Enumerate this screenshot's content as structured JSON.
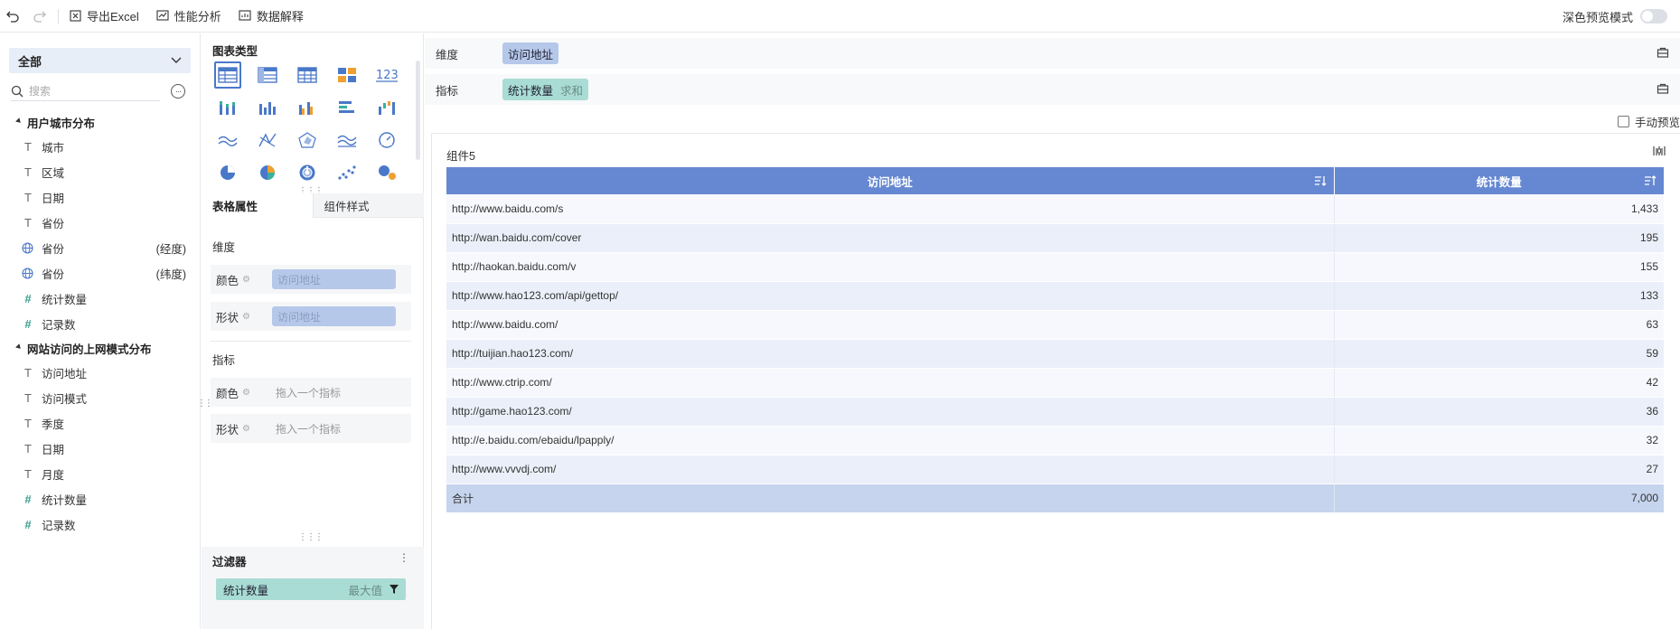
{
  "toolbar": {
    "undo_icon": "undo-icon",
    "redo_icon": "redo-icon",
    "export_label": "导出Excel",
    "perf_label": "性能分析",
    "explain_label": "数据解释",
    "dark_preview_label": "深色预览模式"
  },
  "left": {
    "select_value": "全部",
    "search_placeholder": "搜索",
    "groups": [
      {
        "title": "用户城市分布",
        "fields": [
          {
            "type": "T",
            "label": "城市"
          },
          {
            "type": "T",
            "label": "区域"
          },
          {
            "type": "T",
            "label": "日期"
          },
          {
            "type": "T",
            "label": "省份"
          },
          {
            "type": "globe",
            "label": "省份",
            "suffix": "(经度)"
          },
          {
            "type": "globe",
            "label": "省份",
            "suffix": "(纬度)"
          },
          {
            "type": "#",
            "label": "统计数量"
          },
          {
            "type": "#",
            "label": "记录数"
          }
        ]
      },
      {
        "title": "网站访问的上网模式分布",
        "fields": [
          {
            "type": "T",
            "label": "访问地址"
          },
          {
            "type": "T",
            "label": "访问模式"
          },
          {
            "type": "T",
            "label": "季度"
          },
          {
            "type": "T",
            "label": "日期"
          },
          {
            "type": "T",
            "label": "月度"
          },
          {
            "type": "#",
            "label": "统计数量"
          },
          {
            "type": "#",
            "label": "记录数"
          }
        ]
      }
    ]
  },
  "mid": {
    "chart_type_title": "图表类型",
    "tab_props": "表格属性",
    "tab_style": "组件样式",
    "dimension_title": "维度",
    "metric_title": "指标",
    "color_label": "颜色",
    "shape_label": "形状",
    "dim_color_value": "访问地址",
    "dim_shape_value": "访问地址",
    "metric_placeholder": "拖入一个指标",
    "filter_title": "过滤器",
    "filter_field": "统计数量",
    "filter_agg": "最大值"
  },
  "right": {
    "dimension_label": "维度",
    "dimension_value": "访问地址",
    "metric_label": "指标",
    "metric_value": "统计数量",
    "metric_agg": "求和",
    "manual_preview": "手动预览",
    "component_title": "组件5",
    "table": {
      "headers": [
        "访问地址",
        "统计数量"
      ],
      "rows": [
        [
          "http://www.baidu.com/s",
          "1,433"
        ],
        [
          "http://wan.baidu.com/cover",
          "195"
        ],
        [
          "http://haokan.baidu.com/v",
          "155"
        ],
        [
          "http://www.hao123.com/api/gettop/",
          "133"
        ],
        [
          "http://www.baidu.com/",
          "63"
        ],
        [
          "http://tuijian.hao123.com/",
          "59"
        ],
        [
          "http://www.ctrip.com/",
          "42"
        ],
        [
          "http://game.hao123.com/",
          "36"
        ],
        [
          "http://e.baidu.com/ebaidu/lpapply/",
          "32"
        ],
        [
          "http://www.vvvdj.com/",
          "27"
        ]
      ],
      "total_label": "合计",
      "total_value": "7,000"
    }
  },
  "colors": {
    "header_blue": "#6688d2",
    "dim_pill": "#b6c8ea",
    "metric_pill": "#a9dcd4"
  }
}
